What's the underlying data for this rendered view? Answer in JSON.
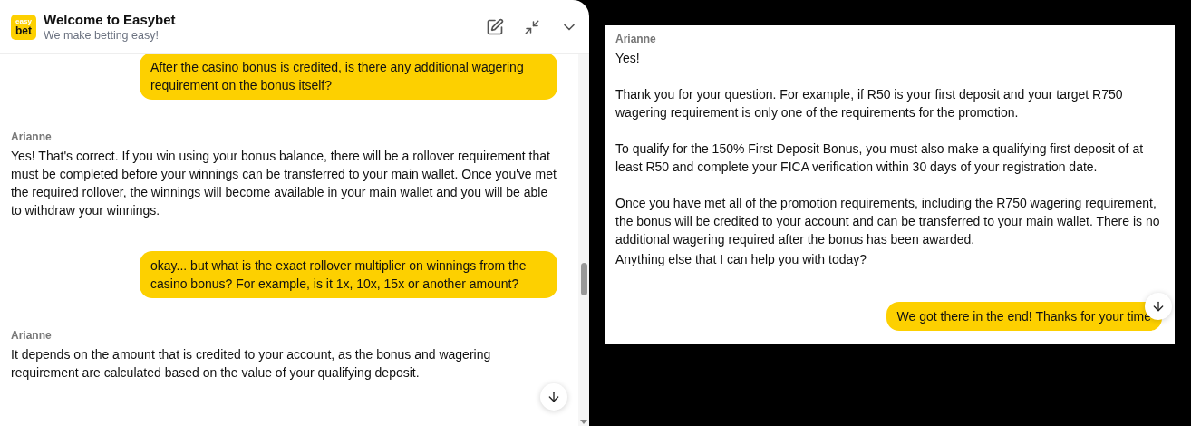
{
  "left_chat": {
    "header": {
      "logo_top": "easy",
      "logo_bottom": "bet",
      "title": "Welcome to Easybet",
      "subtitle": "We make betting easy!"
    },
    "messages": [
      {
        "kind": "user",
        "text": "After the casino bonus is credited, is there any additional wagering requirement on the bonus itself?"
      },
      {
        "kind": "agent",
        "author": "Arianne",
        "paragraphs": [
          "Yes! That's correct. If you win using your bonus balance, there will be a rollover requirement that must be completed before your winnings can be transferred to your main wallet. Once you've met the required rollover, the winnings will become available in your main wallet and you will be able to withdraw your winnings."
        ]
      },
      {
        "kind": "user",
        "text": "okay... but what is the exact rollover multiplier on winnings from the casino bonus? For example, is it 1x, 10x, 15x or another amount?"
      },
      {
        "kind": "agent",
        "author": "Arianne",
        "paragraphs": [
          "It depends on the amount that is credited to your account, as the bonus and wagering requirement are calculated based on the value of your qualifying deposit."
        ]
      }
    ]
  },
  "right_chat": {
    "messages": [
      {
        "kind": "agent",
        "author": "Arianne",
        "paragraphs": [
          "Yes!",
          "Thank you for your question. For example, if R50 is your first deposit and your target R750 wagering requirement is only one of the requirements for the promotion.",
          "To qualify for the 150% First Deposit Bonus, you must also make a qualifying first deposit of at least R50 and complete your FICA verification within 30 days of your registration date.",
          "Once you have met all of the promotion requirements, including the R750 wagering requirement, the bonus will be credited to your account and can be transferred to your main wallet. There is no additional wagering required after the bonus has been awarded."
        ]
      },
      {
        "kind": "agent",
        "paragraphs": [
          "Anything else that I can help you with today?"
        ]
      },
      {
        "kind": "user",
        "text": "We got there in the end! Thanks for your time"
      }
    ]
  }
}
